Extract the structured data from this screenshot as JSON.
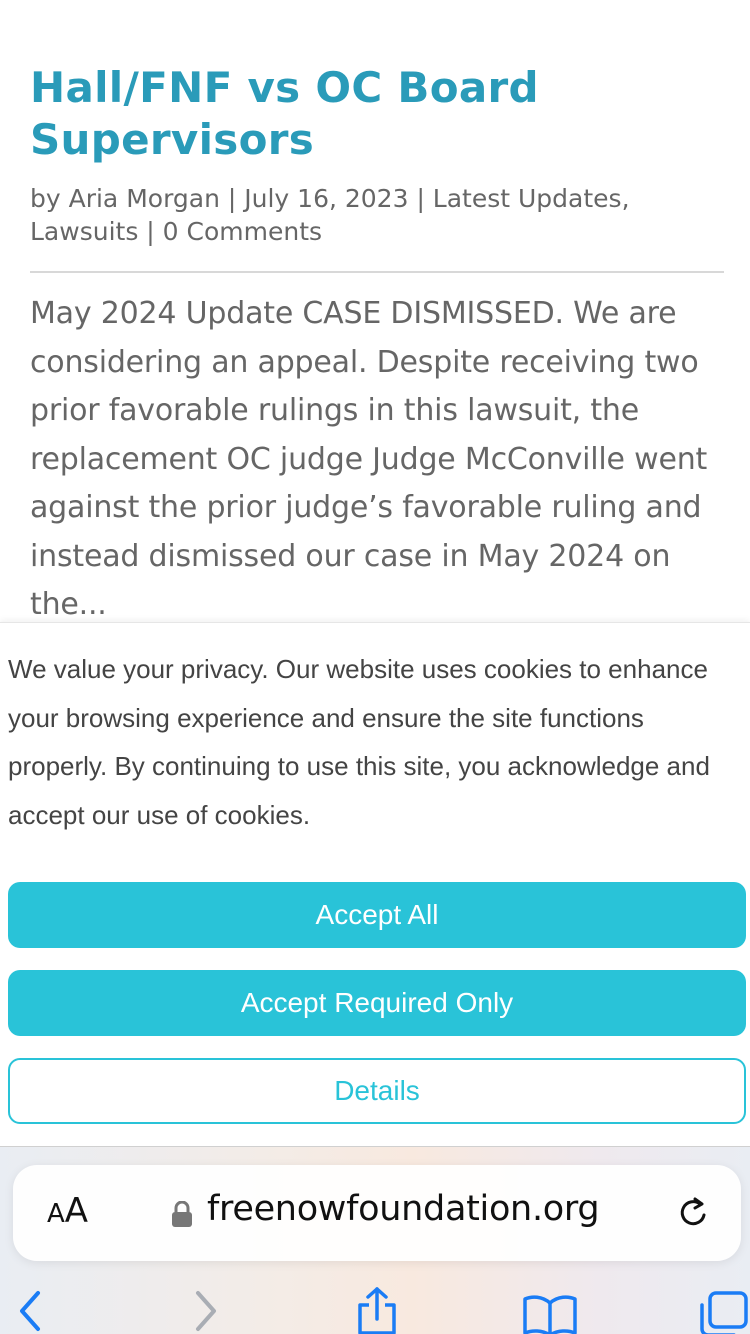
{
  "article": {
    "title": "Hall/FNF vs OC Board Supervisors",
    "meta": "by Aria Morgan | July 16, 2023 | Latest Updates, Lawsuits | 0 Comments",
    "excerpt": "May 2024 Update CASE DISMISSED. We are considering an appeal. Despite receiving two prior favorable rulings in this lawsuit, the replacement OC judge Judge McConville went against the prior judge’s favorable ruling and instead dismissed our case in May 2024 on the..."
  },
  "cookie_banner": {
    "text": "We value your privacy. Our website uses cookies to enhance your browsing experience and ensure the site functions properly. By continuing to use this site, you acknowledge and accept our use of cookies.",
    "accept_all_label": "Accept All",
    "accept_required_label": "Accept Required Only",
    "details_label": "Details"
  },
  "browser": {
    "aa_large": "A",
    "aa_small": "A",
    "url": "freenowfoundation.org"
  },
  "colors": {
    "title": "#2a9bb9",
    "button": "#29c3d8",
    "ios_blue": "#1a7cf5"
  },
  "icons": [
    "lock-icon",
    "reload-icon",
    "back-icon",
    "forward-icon",
    "share-icon",
    "bookmarks-icon",
    "tabs-icon"
  ]
}
